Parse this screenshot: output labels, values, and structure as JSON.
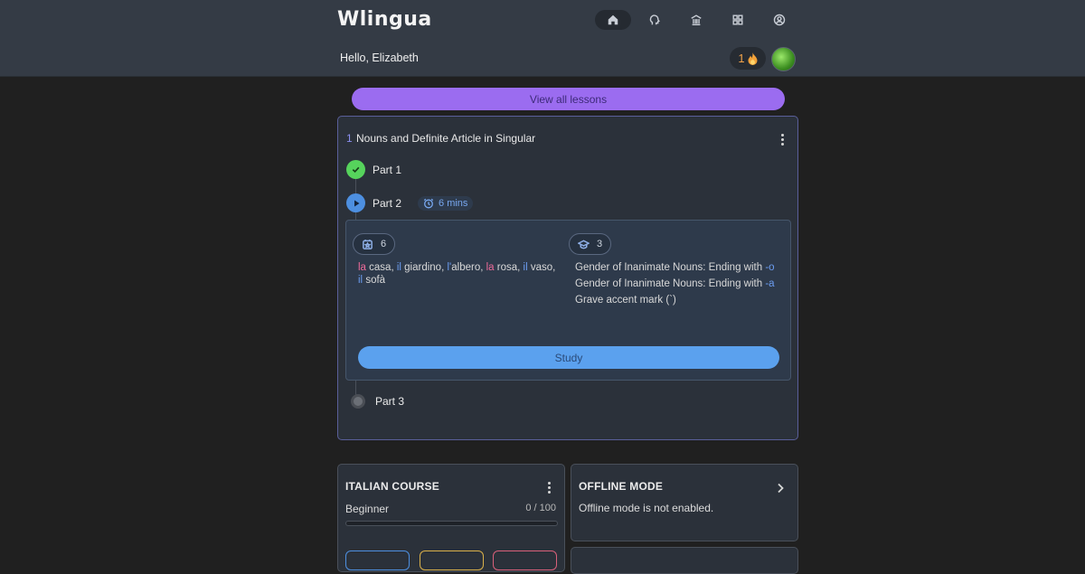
{
  "header": {
    "logo": "Wlingua",
    "greeting": "Hello, Elizabeth",
    "streak_count": "1",
    "nav": [
      {
        "name": "home-icon",
        "active": true
      },
      {
        "name": "brain-icon",
        "active": false
      },
      {
        "name": "library-icon",
        "active": false
      },
      {
        "name": "apps-grid-icon",
        "active": false
      },
      {
        "name": "profile-icon",
        "active": false
      }
    ]
  },
  "lessons": {
    "view_all_label": "View all lessons"
  },
  "lesson": {
    "number": "1",
    "title": "Nouns and Definite Article in Singular",
    "parts": [
      {
        "label": "Part 1",
        "status": "completed"
      },
      {
        "label": "Part 2",
        "status": "in-progress",
        "duration": "6 mins"
      },
      {
        "label": "Part 3",
        "status": "locked"
      }
    ],
    "detail": {
      "vocab_count": "6",
      "grammar_count": "3",
      "vocab": [
        {
          "article": "la",
          "gender": "f",
          "word": " casa",
          "sep": ", "
        },
        {
          "article": "il",
          "gender": "m",
          "word": " giardino",
          "sep": ", "
        },
        {
          "article": "l'",
          "gender": "m",
          "word": "albero",
          "sep": ", "
        },
        {
          "article": "la",
          "gender": "f",
          "word": " rosa",
          "sep": ", "
        },
        {
          "article": "il",
          "gender": "m",
          "word": " vaso",
          "sep": ", "
        },
        {
          "article": "il",
          "gender": "m",
          "word": " sofà",
          "sep": ""
        }
      ],
      "grammar": [
        {
          "text": "Gender of Inanimate Nouns: Ending with ",
          "ending": "-o"
        },
        {
          "text": "Gender of Inanimate Nouns: Ending with ",
          "ending": "-a"
        },
        {
          "text": "Grave accent mark (`)",
          "ending": ""
        }
      ],
      "study_label": "Study"
    }
  },
  "course": {
    "title": "ITALIAN COURSE",
    "level": "Beginner",
    "progress_text": "0 / 100",
    "progress": 0,
    "mini_colors": [
      "#4d8fe0",
      "#d9b04a",
      "#d9607a"
    ]
  },
  "offline": {
    "title": "OFFLINE MODE",
    "description": "Offline mode is not enabled."
  },
  "colors": {
    "accent_purple": "#9b6cf0",
    "accent_blue": "#5ba1ee",
    "success_green": "#56d35c",
    "article_feminine": "#ee6b9a",
    "article_masculine": "#6b9cf0"
  }
}
